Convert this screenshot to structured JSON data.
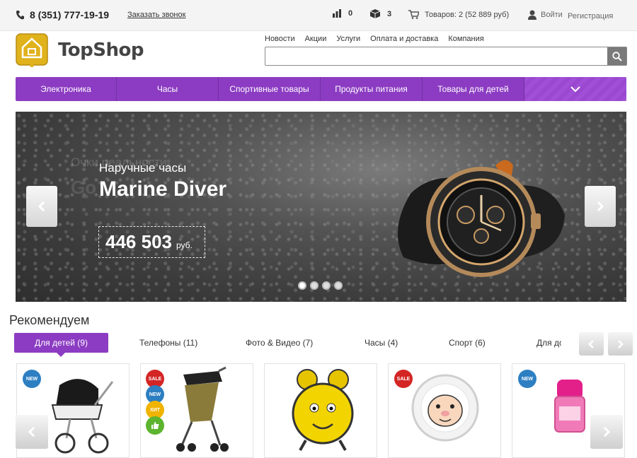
{
  "topbar": {
    "phone": "8 (351) 777-19-19",
    "callback": "Заказать звонок",
    "compare_count": "0",
    "box_count": "3",
    "cart": "Товаров: 2 (52 889 руб)",
    "login": "Войти",
    "register": "Регистрация"
  },
  "logo": {
    "text": "TopShop"
  },
  "topnav": [
    "Новости",
    "Акции",
    "Услуги",
    "Оплата и доставка",
    "Компания"
  ],
  "search": {
    "placeholder": ""
  },
  "categories": [
    "Электроника",
    "Часы",
    "Спортивные товары",
    "Продукты питания",
    "Товары для детей"
  ],
  "slider": {
    "ghost_sub": "Очки реальности",
    "ghost_title": "Go",
    "subtitle": "Наручные часы",
    "title": "Marine Diver",
    "price": "446 503",
    "currency": "руб.",
    "active_dot": 0,
    "dot_count": 4
  },
  "recommended": {
    "title": "Рекомендуем",
    "tabs": [
      "Для детей (9)",
      "Телефоны (11)",
      "Фото & Видео (7)",
      "Часы (4)",
      "Спорт (6)",
      "Для до"
    ]
  },
  "badges": {
    "new": "NEW",
    "sale": "SALE",
    "hit": "ХИТ"
  },
  "colors": {
    "accent": "#8c3cc2",
    "new": "#2d7fc2",
    "sale": "#d42525",
    "hit": "#f0b400"
  }
}
